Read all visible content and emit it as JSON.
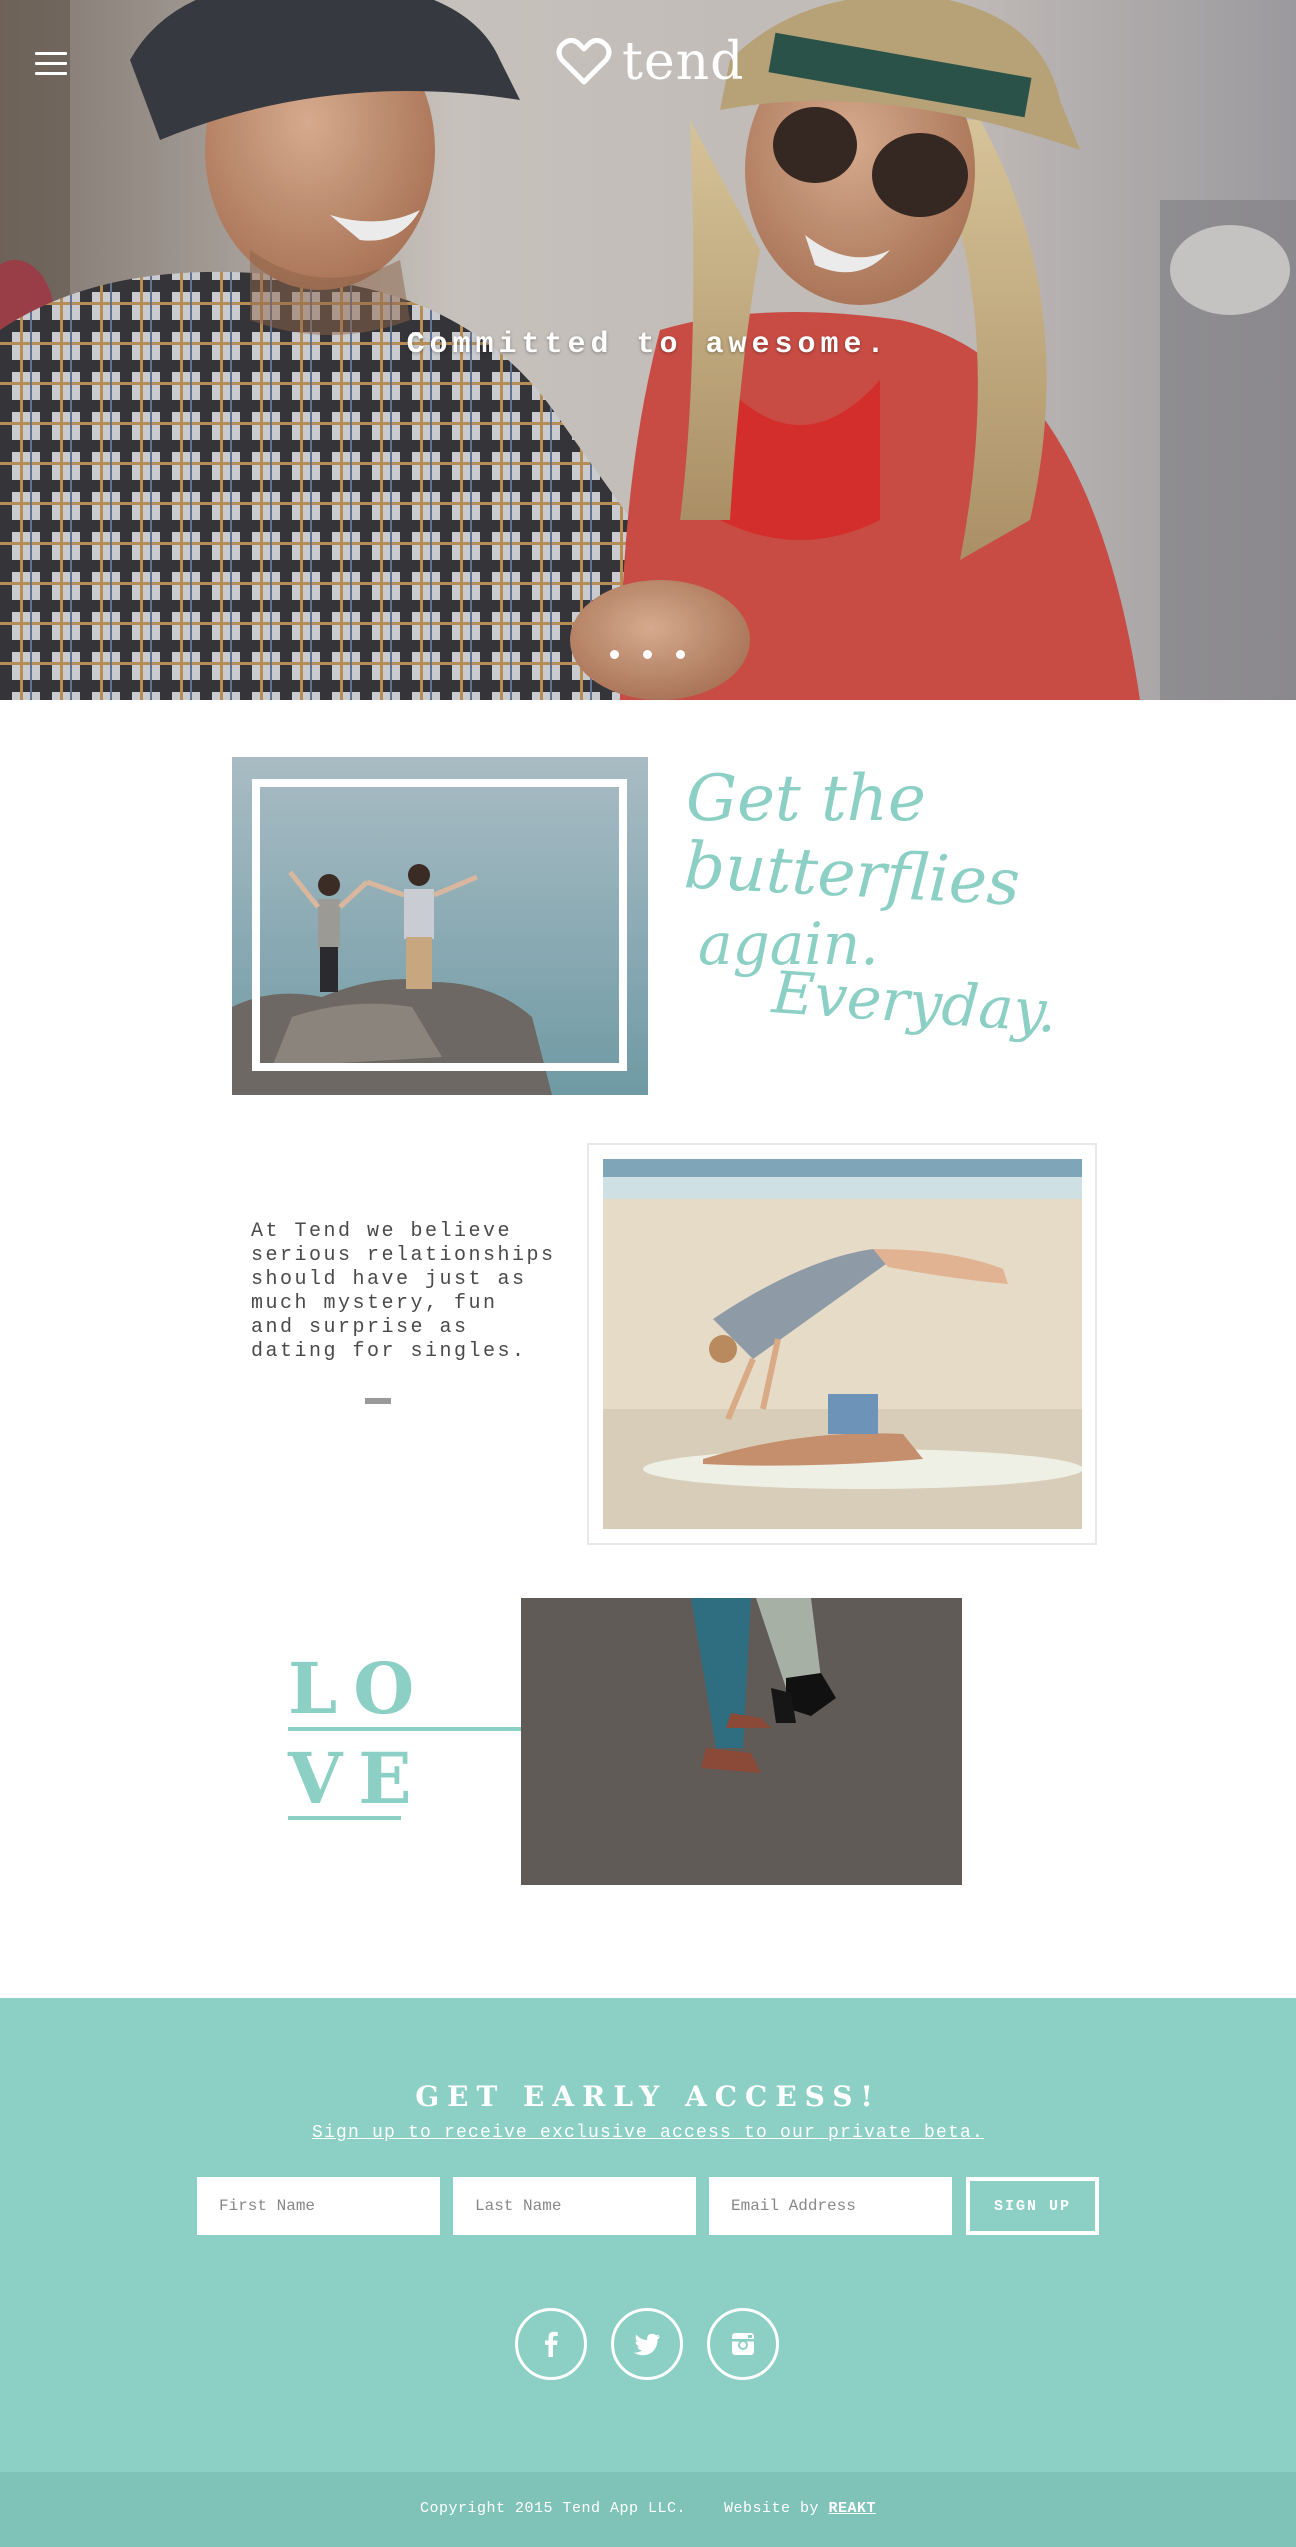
{
  "header": {
    "menu_icon": "hamburger-icon",
    "logo_icon": "heart-outline-icon",
    "logo_text": "tend"
  },
  "hero": {
    "tagline": "Committed to awesome.",
    "slides": 3
  },
  "feature": {
    "script_lines": [
      "Get the",
      "butterflies",
      "again.",
      "Everyday."
    ]
  },
  "about": {
    "text": "At Tend we believe\nserious relationships\nshould have just as\nmuch mystery, fun\nand surprise as\ndating for singles."
  },
  "love": {
    "line1": "LO",
    "line2": "VE"
  },
  "signup": {
    "title": "GET EARLY ACCESS!",
    "subtitle": "Sign up to receive exclusive access to our private beta.",
    "first_name_placeholder": "First Name",
    "last_name_placeholder": "Last Name",
    "email_placeholder": "Email Address",
    "button_label": "SIGN UP"
  },
  "social": [
    "facebook-icon",
    "twitter-icon",
    "instagram-icon"
  ],
  "footer": {
    "copyright": "Copyright 2015 Tend App LLC.",
    "credit_prefix": "Website by",
    "credit_link": "REAKT"
  },
  "colors": {
    "accent": "#8ccfc4",
    "footer_bg": "#7fc2b8"
  }
}
